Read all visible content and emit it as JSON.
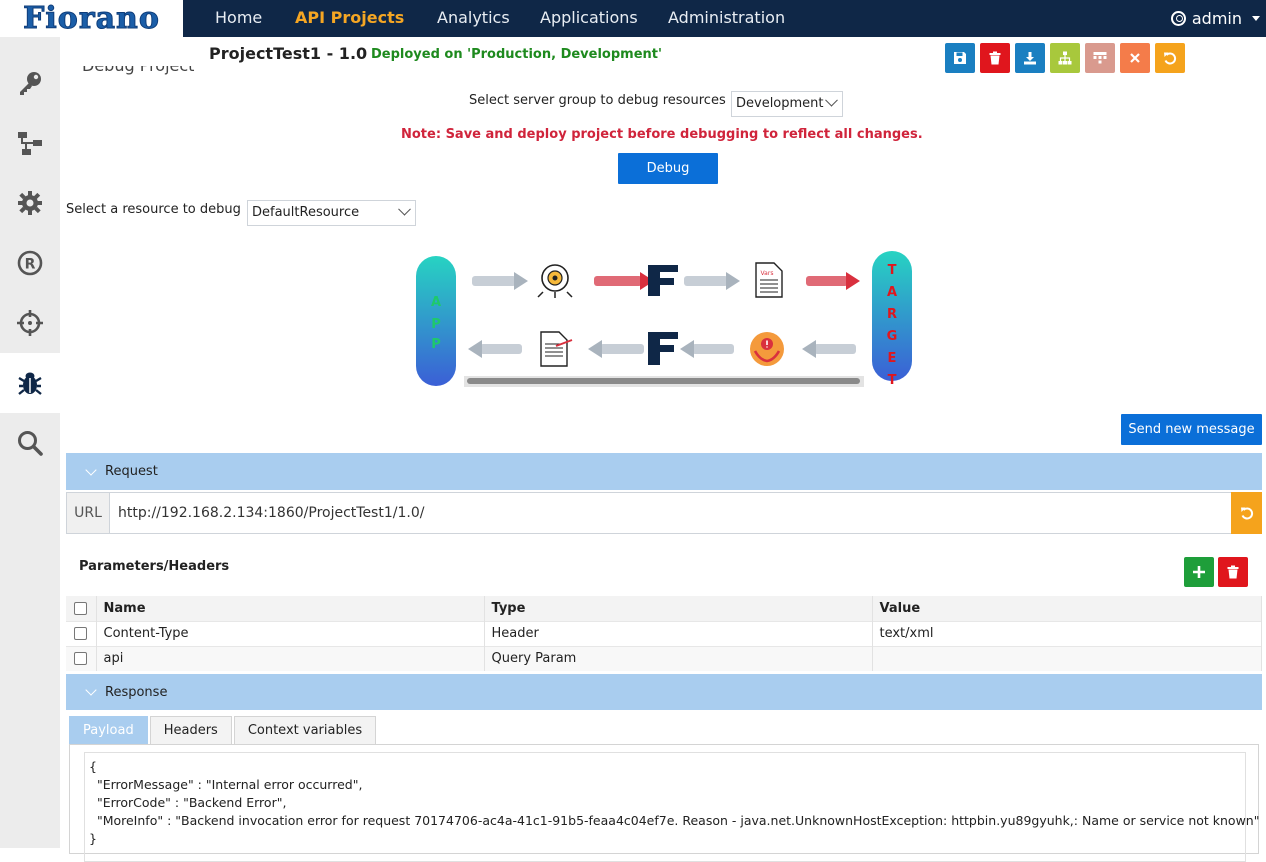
{
  "brand": {
    "logo": "Fiorano"
  },
  "nav": {
    "items": [
      "Home",
      "API Projects",
      "Analytics",
      "Applications",
      "Administration"
    ],
    "user": "admin"
  },
  "sidebar": {
    "items": [
      "key-icon",
      "flow-icon",
      "gear-icon",
      "registered-icon",
      "crosshair-icon",
      "bug-icon",
      "search-icon"
    ],
    "active": "bug-icon"
  },
  "project": {
    "title": "ProjectTest1 - 1.0",
    "deploy_status": "Deployed on 'Production, Development'",
    "cut_heading": "Debug Project"
  },
  "toolbar": {
    "buttons": [
      {
        "icon": "save-icon",
        "color": "#1a7fc1"
      },
      {
        "icon": "trash-icon",
        "color": "#e0161d"
      },
      {
        "icon": "download-icon",
        "color": "#1a7fc1"
      },
      {
        "icon": "sitemap-icon",
        "color": "#a8c83c"
      },
      {
        "icon": "table-icon",
        "color": "#d99a8e"
      },
      {
        "icon": "close-icon",
        "color": "#f47c4a"
      },
      {
        "icon": "undo-icon",
        "color": "#f5a31c"
      }
    ]
  },
  "debug": {
    "server_group_label": "Select server group to debug resources",
    "server_group_value": "Development",
    "note": "Note: Save and deploy project before debugging to reflect all changes.",
    "debug_button": "Debug",
    "resource_label": "Select a resource to debug",
    "resource_value": "DefaultResource"
  },
  "flow": {
    "left_label": [
      "A",
      "P",
      "P"
    ],
    "right_label": [
      "T",
      "A",
      "R",
      "G",
      "E",
      "T"
    ],
    "left_color": "#1ec96b",
    "right_color": "#e0161d"
  },
  "send_button": "Send new message",
  "request": {
    "title": "Request",
    "url_label": "URL",
    "url": "http://192.168.2.134:1860/ProjectTest1/1.0/"
  },
  "params": {
    "title": "Parameters/Headers",
    "columns": [
      "Name",
      "Type",
      "Value"
    ],
    "rows": [
      {
        "name": "Content-Type",
        "type": "Header",
        "value": "text/xml"
      },
      {
        "name": "api",
        "type": "Query Param",
        "value": ""
      }
    ]
  },
  "response": {
    "title": "Response",
    "tabs": [
      "Payload",
      "Headers",
      "Context variables"
    ],
    "active_tab": "Payload",
    "payload": "{\n  \"ErrorMessage\" : \"Internal error occurred\",\n  \"ErrorCode\" : \"Backend Error\",\n  \"MoreInfo\" : \"Backend invocation error for request 70174706-ac4a-41c1-91b5-feaa4c04ef7e. Reason - java.net.UnknownHostException: httpbin.yu89gyuhk,: Name or service not known\"\n}"
  }
}
